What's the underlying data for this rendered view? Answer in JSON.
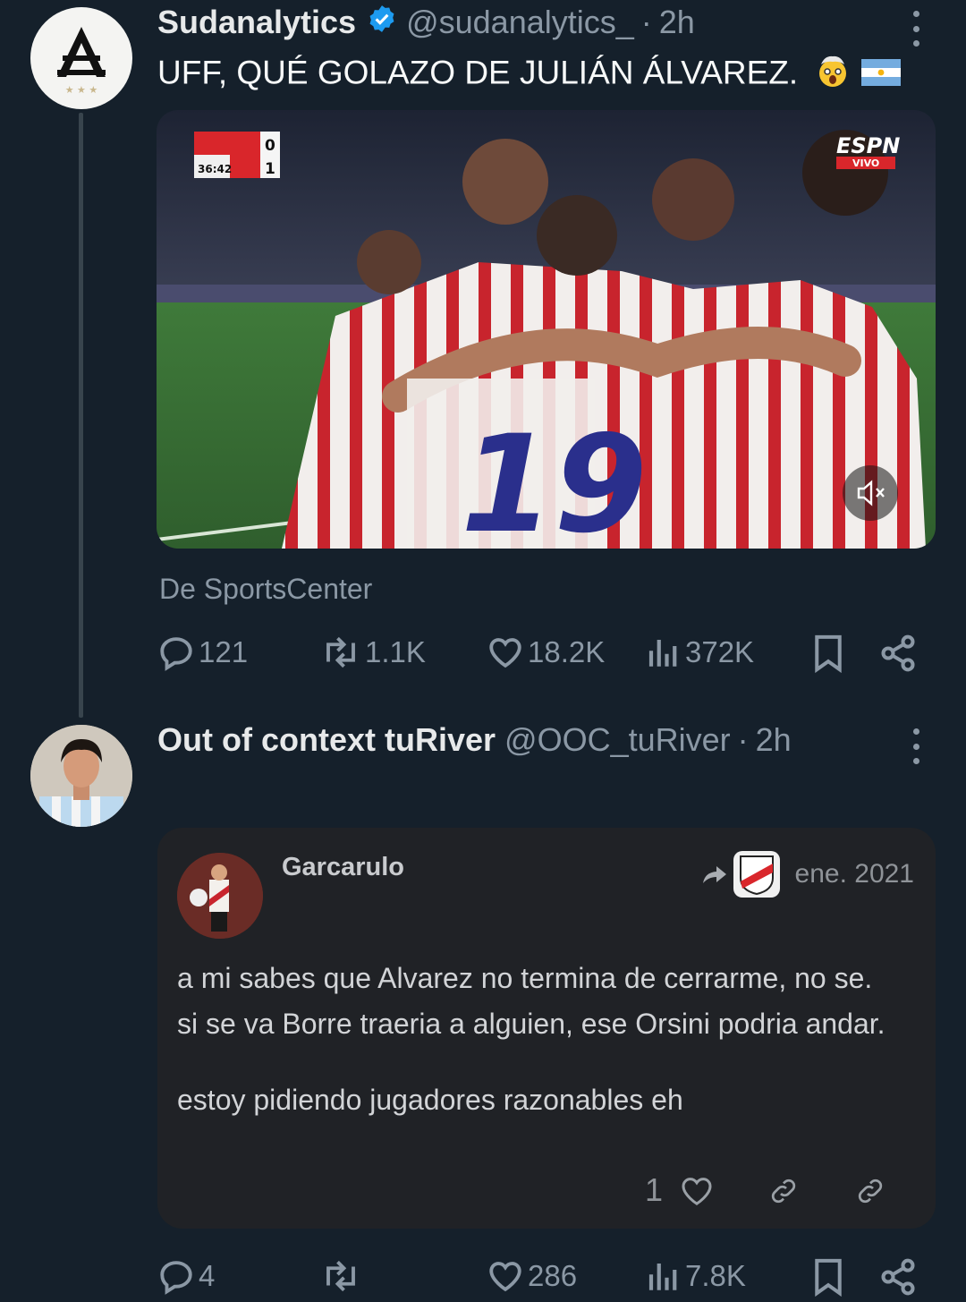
{
  "tweet1": {
    "name": "Sudanalytics",
    "handle": "@sudanalytics_",
    "separator": "·",
    "time": "2h",
    "text": "UFF, QUÉ GOLAZO DE JULIÁN ÁLVAREZ.",
    "media": {
      "score_home": "0",
      "score_away": "1",
      "clock": "36:42",
      "broadcaster": "ESPN",
      "live_badge": "VIVO",
      "jersey_number": "19"
    },
    "source": "De SportsCenter",
    "actions": {
      "replies": "121",
      "reposts": "1.1K",
      "likes": "18.2K",
      "views": "372K"
    }
  },
  "tweet2": {
    "name": "Out of context tuRiver",
    "handle": "@OOC_tuRiver",
    "separator": "·",
    "time": "2h",
    "quote": {
      "author": "Garcarulo",
      "date": "ene. 2021",
      "line1": "a mi sabes que Alvarez no termina de cerrarme, no se.",
      "line2": "si se va Borre traeria a alguien, ese Orsini podria andar.",
      "line3": "estoy pidiendo jugadores razonables eh",
      "like_count": "1"
    },
    "actions": {
      "replies": "4",
      "reposts": "",
      "likes": "286",
      "views": "7.8K"
    }
  },
  "colors": {
    "background": "#15202b",
    "muted": "#8b98a5",
    "verified": "#1d9bf0",
    "quote_bg": "#202226"
  }
}
